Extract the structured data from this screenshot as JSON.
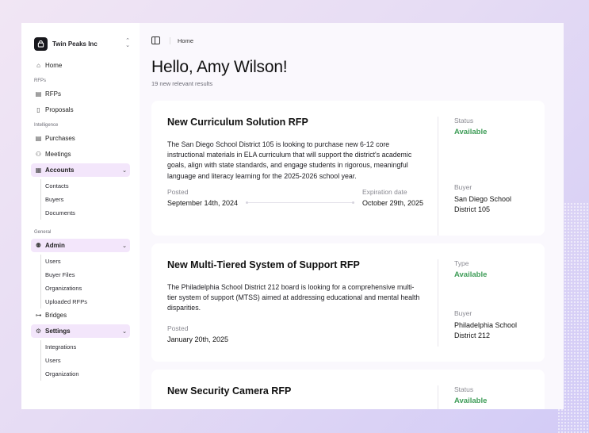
{
  "org": {
    "name": "Twin Peaks Inc"
  },
  "sidebar": {
    "home": "Home",
    "sections": {
      "rfps": "RFPs",
      "intelligence": "Intelligence",
      "general": "General"
    },
    "rfps_items": [
      "RFPs",
      "Proposals"
    ],
    "intel_items": [
      "Purchases",
      "Meetings"
    ],
    "accounts": {
      "label": "Accounts",
      "children": [
        "Contacts",
        "Buyers",
        "Documents"
      ]
    },
    "admin": {
      "label": "Admin",
      "children": [
        "Users",
        "Buyer Files",
        "Organizations",
        "Uploaded RFPs"
      ]
    },
    "bridges": "Bridges",
    "settings": {
      "label": "Settings",
      "children": [
        "Integrations",
        "Users",
        "Organization"
      ]
    }
  },
  "header": {
    "breadcrumb": "Home"
  },
  "greeting": {
    "title": "Hello, Amy Wilson!",
    "subtitle": "19 new relevant results"
  },
  "cards": [
    {
      "title": "New Curriculum Solution RFP",
      "description": "The San Diego School District 105 is looking to purchase new 6-12 core instructional materials in  ELA curriculum that will support the district's academic goals, align with state standards, and engage students in rigorous, meaningful language and literacy learning for the 2025-2026 school year.",
      "posted_label": "Posted",
      "posted": "September 14th, 2024",
      "expiration_label": "Expiration date",
      "expiration": "October 29th, 2025",
      "status_label": "Status",
      "status": "Available",
      "buyer_label": "Buyer",
      "buyer": "San Diego School District 105"
    },
    {
      "title": "New Multi-Tiered System of Support RFP",
      "description": "The Philadelphia School District 212 board is looking for a comprehensive multi-tier system of support (MTSS) aimed at addressing educational and mental health disparities.",
      "posted_label": "Posted",
      "posted": "January 20th, 2025",
      "status_label": "Type",
      "status": "Available",
      "buyer_label": "Buyer",
      "buyer": "Philadelphia School District 212"
    },
    {
      "title": "New Security Camera RFP",
      "status_label": "Status",
      "status": "Available"
    }
  ],
  "colors": {
    "accent_bg": "#f3e6fb",
    "status_green": "#3f9d58"
  }
}
